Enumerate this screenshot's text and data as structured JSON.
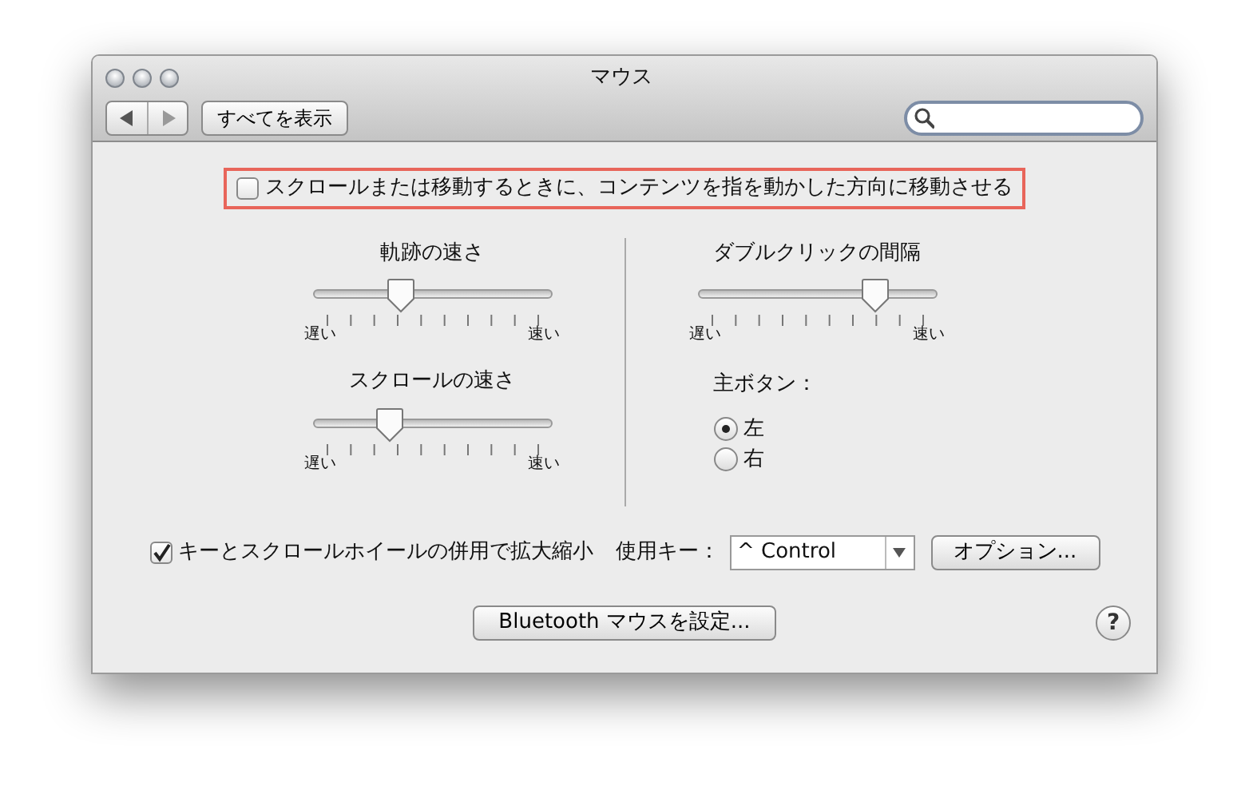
{
  "window": {
    "title": "マウス"
  },
  "toolbar": {
    "show_all_button": "すべてを表示"
  },
  "natural_scroll": {
    "label": "スクロールまたは移動するときに、コンテンツを指を動かした方向に移動させる",
    "checked": false,
    "highlighted": true
  },
  "left_sliders": [
    {
      "title": "軌跡の速さ",
      "level": 0.35,
      "min_label": "遅い",
      "max_label": "速い"
    },
    {
      "title": "スクロールの速さ",
      "level": 0.3,
      "min_label": "遅い",
      "max_label": "速い"
    }
  ],
  "right_sliders": [
    {
      "title": "ダブルクリックの間隔",
      "level": 0.78,
      "min_label": "遅い",
      "max_label": "速い"
    }
  ],
  "primary_button": {
    "label": "主ボタン：",
    "options": [
      {
        "label": "左",
        "selected": true
      },
      {
        "label": "右",
        "selected": false
      }
    ]
  },
  "zoom": {
    "label": "キーとスクロールホイールの併用で拡大縮小",
    "checked": true,
    "key_label": "使用キー：",
    "key_value": "^ Control",
    "options_button": "オプション..."
  },
  "bluetooth_button": "Bluetooth マウスを設定...",
  "help_button": "?"
}
